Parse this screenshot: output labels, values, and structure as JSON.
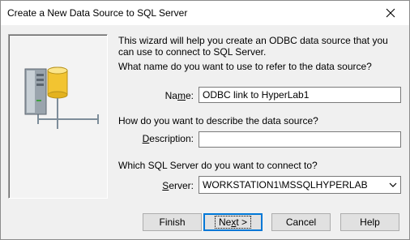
{
  "window": {
    "title": "Create a New Data Source to SQL Server"
  },
  "intro_text": "This wizard will help you create an ODBC data source that you can use to connect to SQL Server.",
  "name_section": {
    "question": "What name do you want to use to refer to the data source?",
    "label": "Name:",
    "value": "ODBC link to HyperLab1"
  },
  "description_section": {
    "question": "How do you want to describe the data source?",
    "label": "Description:",
    "value": ""
  },
  "server_section": {
    "question": "Which SQL Server do you want to connect to?",
    "label": "Server:",
    "value": "WORKSTATION1\\MSSQLHYPERLAB"
  },
  "buttons": {
    "finish": "Finish",
    "next": "Next >",
    "cancel": "Cancel",
    "help": "Help"
  },
  "icons": {
    "close": "close-icon",
    "illustration": "server-database-network-icon",
    "dropdown": "chevron-down-icon"
  }
}
